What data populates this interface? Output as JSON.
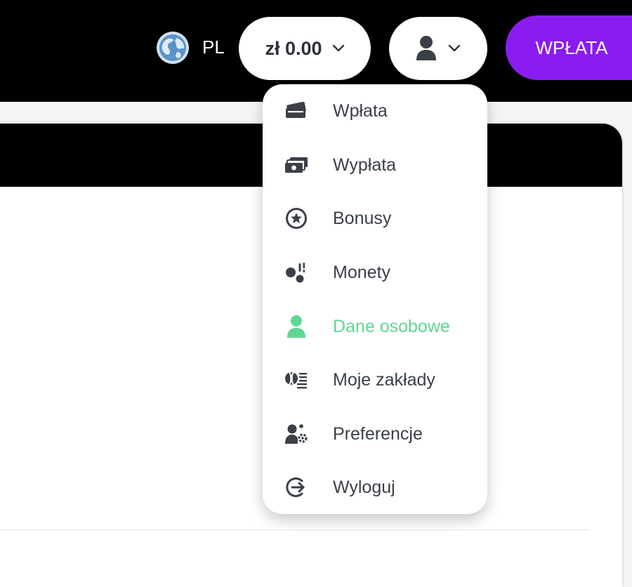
{
  "header": {
    "language": "PL",
    "balance": "zł 0.00",
    "deposit_label": "WPŁATA"
  },
  "account_menu": {
    "items": [
      {
        "label": "Wpłata",
        "icon": "wallet-card-icon",
        "active": false
      },
      {
        "label": "Wypłata",
        "icon": "cash-icon",
        "active": false
      },
      {
        "label": "Bonusy",
        "icon": "star-circle-icon",
        "active": false
      },
      {
        "label": "Monety",
        "icon": "coins-icon",
        "active": false
      },
      {
        "label": "Dane osobowe",
        "icon": "user-icon",
        "active": true
      },
      {
        "label": "Moje zakłady",
        "icon": "ball-list-icon",
        "active": false
      },
      {
        "label": "Preferencje",
        "icon": "user-settings-icon",
        "active": false
      },
      {
        "label": "Wyloguj",
        "icon": "logout-icon",
        "active": false
      }
    ]
  },
  "colors": {
    "accent": "#8a1cf0",
    "active_item": "#5fd694",
    "menu_text": "#3b4048",
    "header_bg": "#000000"
  }
}
